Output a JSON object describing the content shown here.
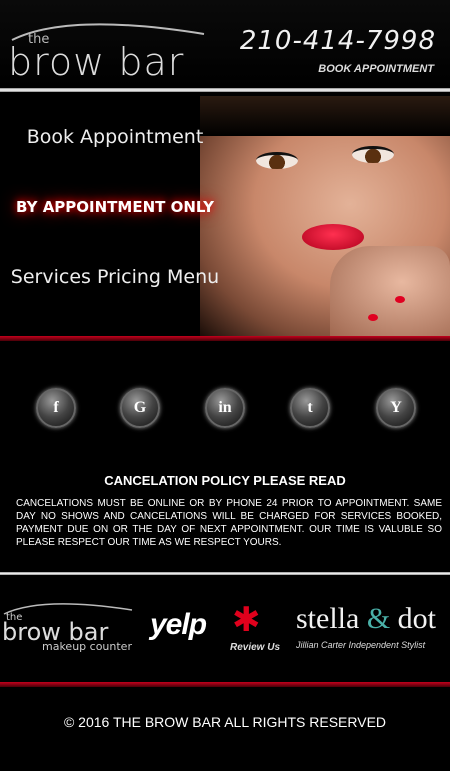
{
  "header": {
    "logo_the": "the",
    "logo_text": "brow bar",
    "phone": "210-414-7998",
    "book_link": "BOOK APPOINTMENT"
  },
  "hero": {
    "book_label": "Book Appointment",
    "appointment_only": "BY APPOINTMENT ONLY",
    "menu_label": "Services Pricing Menu"
  },
  "social": [
    {
      "name": "facebook-icon",
      "glyph": "f"
    },
    {
      "name": "google-plus-icon",
      "glyph": "G"
    },
    {
      "name": "linkedin-icon",
      "glyph": "in"
    },
    {
      "name": "twitter-icon",
      "glyph": "t"
    },
    {
      "name": "yahoo-icon",
      "glyph": "Y"
    }
  ],
  "policy": {
    "title": "CANCELATION POLICY PLEASE READ",
    "text": "CANCELATIONS MUST BE  ONLINE OR BY PHONE 24 PRIOR TO APPOINTMENT. SAME DAY NO SHOWS AND CANCELATIONS WILL BE CHARGED FOR SERVICES BOOKED, PAYMENT DUE ON OR THE DAY OF NEXT APPOINTMENT. OUR TIME IS VALUBLE SO PLEASE RESPECT OUR TIME AS WE RESPECT YOURS."
  },
  "partners": {
    "browbar_the": "the",
    "browbar_brand": "brow bar",
    "browbar_sub": "makeup counter",
    "yelp_word": "yelp",
    "yelp_star": "✱",
    "yelp_review": "Review Us",
    "stella_left": "stella ",
    "stella_amp": "&",
    "stella_right": " dot",
    "stella_sub": "Jillian Carter Independent Stylist"
  },
  "footer": {
    "copyright": "©  2016 THE BROW BAR ALL RIGHTS RESERVED"
  },
  "colors": {
    "accent_red": "#c4001c",
    "stella_teal": "#4ab0a8"
  }
}
